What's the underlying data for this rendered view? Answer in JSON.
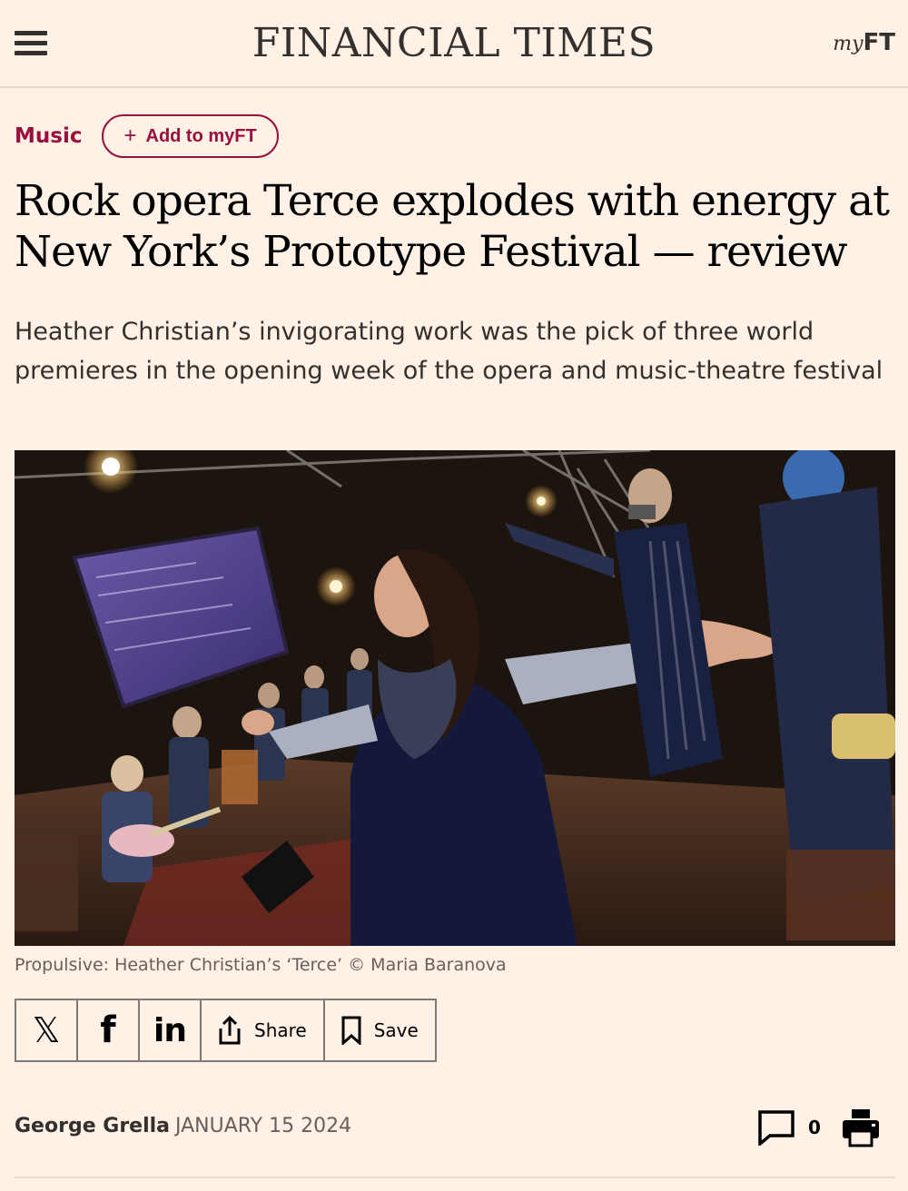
{
  "header": {
    "masthead": "FINANCIAL TIMES",
    "myft_prefix": "my",
    "myft_suffix": "FT",
    "menu_icon": "hamburger-menu-icon"
  },
  "article": {
    "topic": "Music",
    "add_myft_label": "Add to myFT",
    "add_myft_icon": "+",
    "headline": "Rock opera Terce explodes with energy at New York’s Prototype Festival — review",
    "standfirst": "Heather Christian’s invigorating work was the pick of three world premieres in the opening week of the opera and music-theatre festival",
    "image_caption": "Propulsive: Heather Christian’s ‘Terce’ © Maria Baranova",
    "author": "George Grella",
    "date": "JANUARY 15 2024",
    "comment_count": "0"
  },
  "share": {
    "x_icon": "𝕏",
    "facebook_icon": "f",
    "linkedin_icon": "in",
    "share_label": "Share",
    "save_label": "Save"
  },
  "colors": {
    "background": "#fff1e5",
    "claret": "#990f3d",
    "text": "#33302e"
  }
}
